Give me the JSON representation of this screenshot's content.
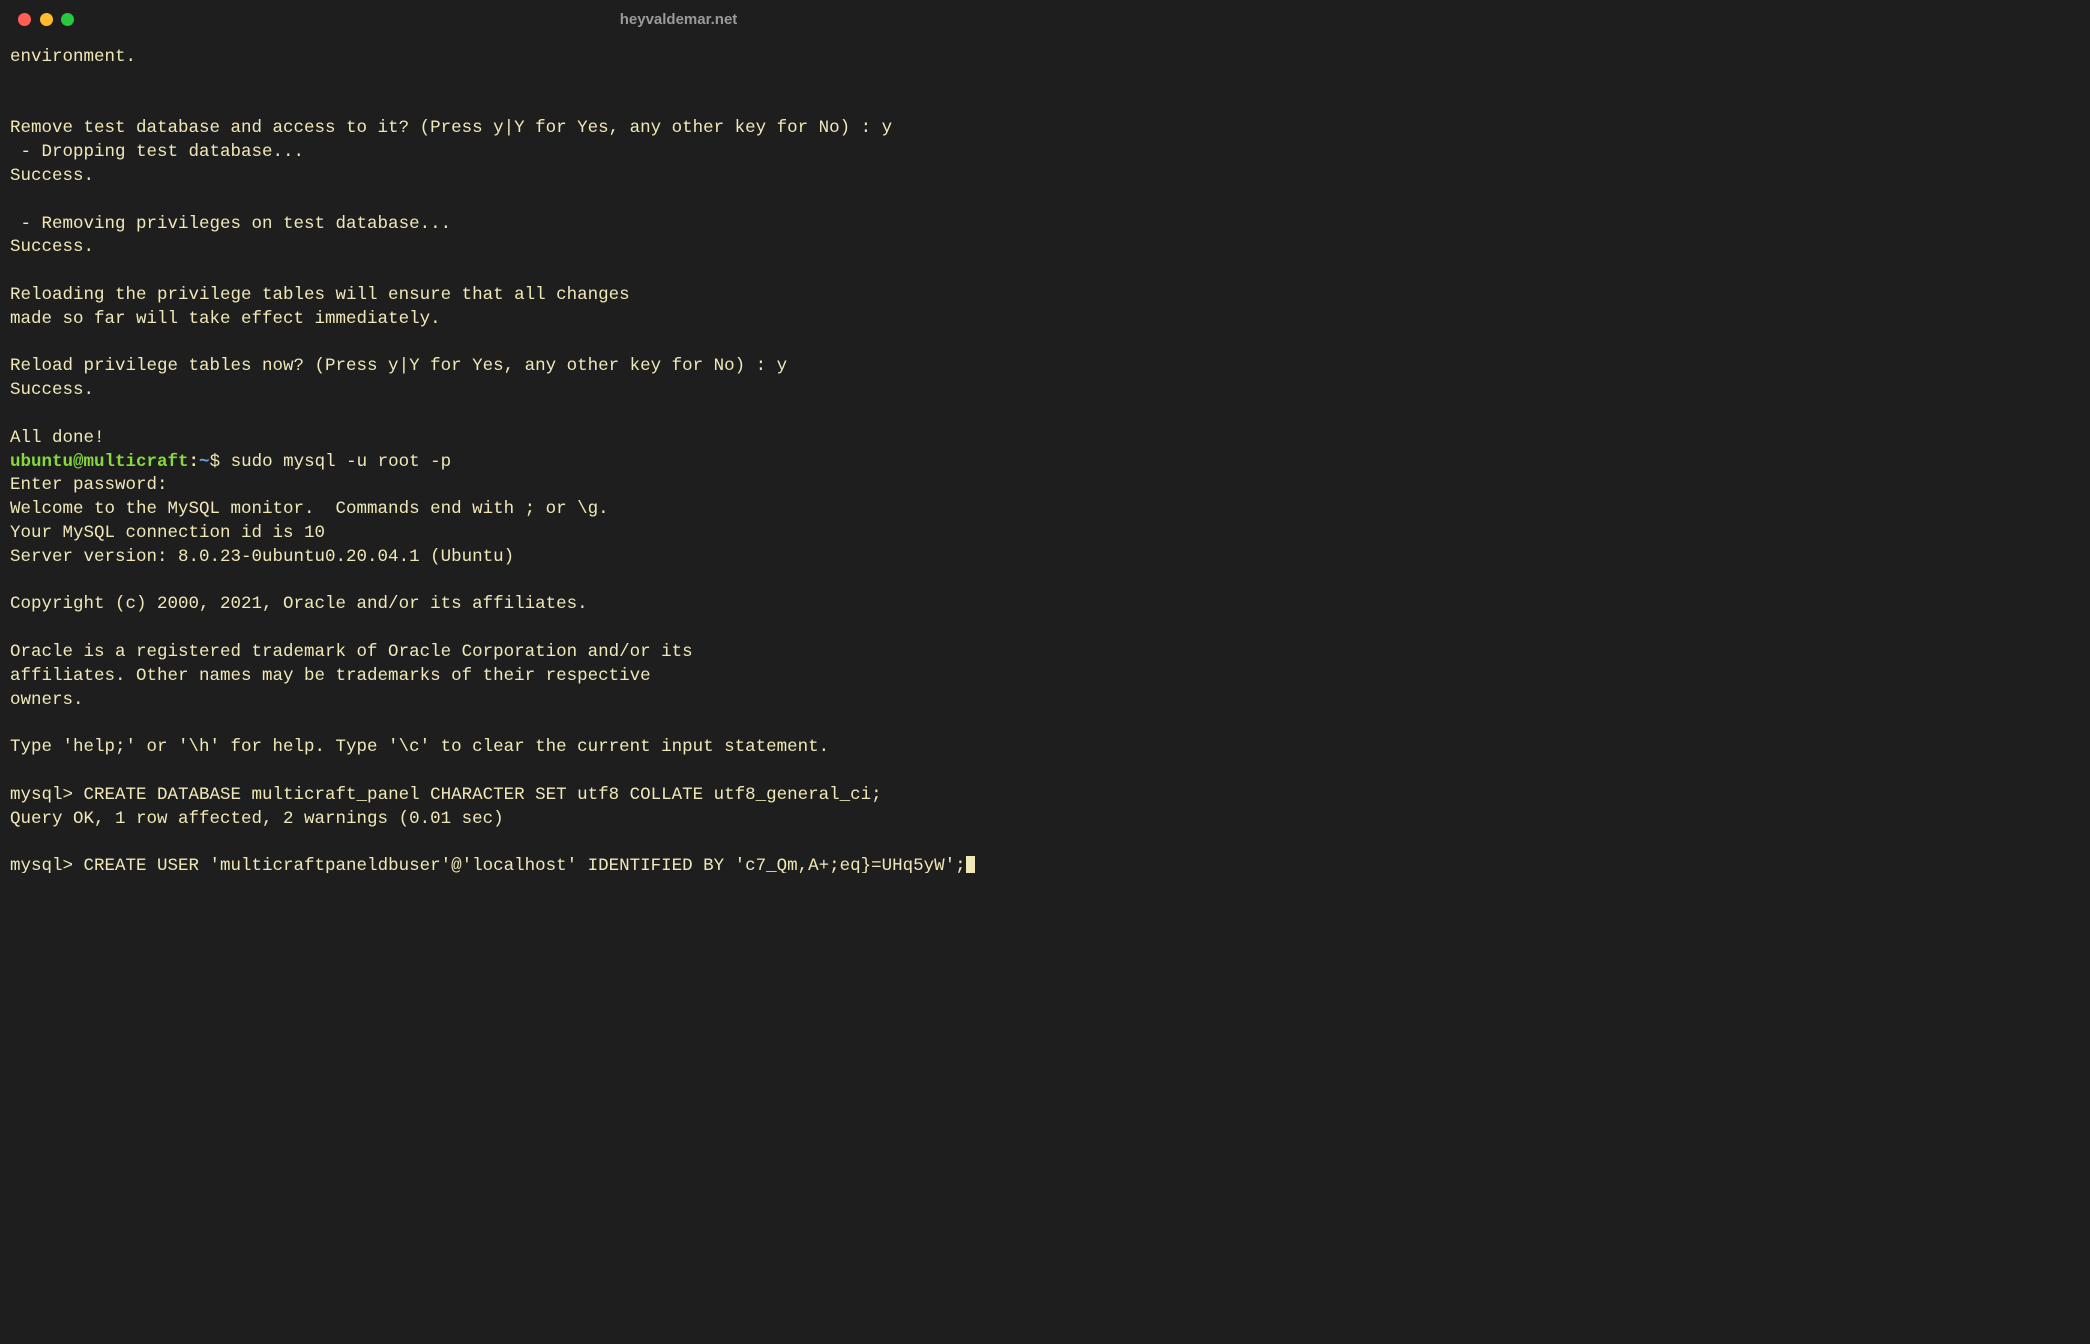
{
  "window": {
    "title": "heyvaldemar.net"
  },
  "traffic": {
    "red": "#ff5f56",
    "yellow": "#ffbd2e",
    "green": "#27c93f"
  },
  "prompt": {
    "user_host": "ubuntu@multicraft",
    "colon": ":",
    "path": "~",
    "symbol": "$ "
  },
  "sudo_cmd": "sudo mysql -u root -p",
  "mysql_prompt1": "mysql> ",
  "mysql_cmd1": "CREATE DATABASE multicraft_panel CHARACTER SET utf8 COLLATE utf8_general_ci;",
  "mysql_prompt2": "mysql> ",
  "mysql_cmd2": "CREATE USER 'multicraftpaneldbuser'@'localhost' IDENTIFIED BY 'c7_Qm,A+;eq}=UHq5yW';",
  "lines": {
    "l01": "environment.",
    "l02": "",
    "l03": "",
    "l04": "Remove test database and access to it? (Press y|Y for Yes, any other key for No) : y",
    "l05": " - Dropping test database...",
    "l06": "Success.",
    "l07": "",
    "l08": " - Removing privileges on test database...",
    "l09": "Success.",
    "l10": "",
    "l11": "Reloading the privilege tables will ensure that all changes",
    "l12": "made so far will take effect immediately.",
    "l13": "",
    "l14": "Reload privilege tables now? (Press y|Y for Yes, any other key for No) : y",
    "l15": "Success.",
    "l16": "",
    "l17": "All done!",
    "l18": "Enter password:",
    "l19": "Welcome to the MySQL monitor.  Commands end with ; or \\g.",
    "l20": "Your MySQL connection id is 10",
    "l21": "Server version: 8.0.23-0ubuntu0.20.04.1 (Ubuntu)",
    "l22": "",
    "l23": "Copyright (c) 2000, 2021, Oracle and/or its affiliates.",
    "l24": "",
    "l25": "Oracle is a registered trademark of Oracle Corporation and/or its",
    "l26": "affiliates. Other names may be trademarks of their respective",
    "l27": "owners.",
    "l28": "",
    "l29": "Type 'help;' or '\\h' for help. Type '\\c' to clear the current input statement.",
    "l30": "",
    "l31": "Query OK, 1 row affected, 2 warnings (0.01 sec)",
    "l32": ""
  }
}
